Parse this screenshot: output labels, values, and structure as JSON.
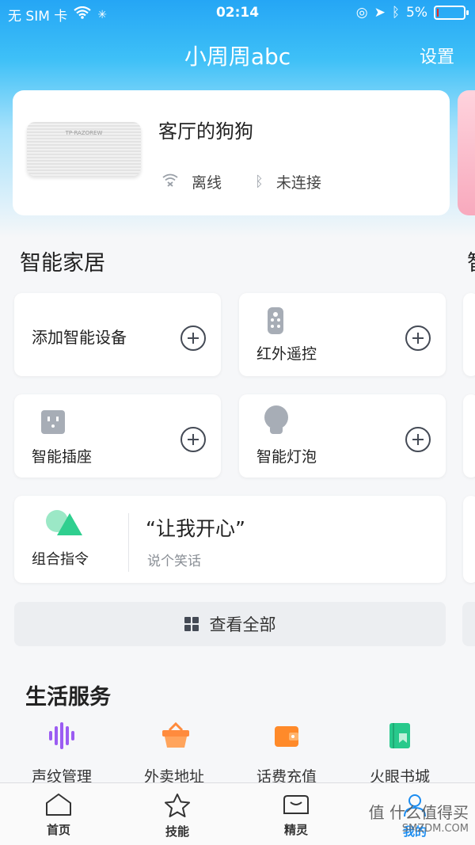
{
  "status_bar": {
    "carrier": "无 SIM 卡",
    "time": "02:14",
    "battery": "5%",
    "battery_level": 0.05
  },
  "nav": {
    "title": "小周周abc",
    "settings_label": "设置"
  },
  "device": {
    "name": "客厅的狗狗",
    "wifi_status": "离线",
    "bt_status": "未连接",
    "brand": "TP-RAZOREW"
  },
  "smart_home": {
    "title": "智能家居",
    "peek_title": "智",
    "add_device": "添加智能设备",
    "ir_remote": "红外遥控",
    "smart_socket": "智能插座",
    "smart_bulb": "智能灯泡"
  },
  "combo": {
    "label": "组合指令",
    "command": "“让我开心”",
    "subtitle": "说个笑话"
  },
  "view_all": "查看全部",
  "life_services": {
    "title": "生活服务",
    "items": [
      {
        "label": "声纹管理",
        "icon": "voiceprint-icon",
        "color": "#9b5cf2"
      },
      {
        "label": "外卖地址",
        "icon": "takeout-icon",
        "color": "#ff8b3d"
      },
      {
        "label": "话费充值",
        "icon": "wallet-icon",
        "color": "#ff8a2a"
      },
      {
        "label": "火眼书城",
        "icon": "book-icon",
        "color": "#28c98c"
      }
    ]
  },
  "tabbar": {
    "items": [
      {
        "label": "首页",
        "icon": "home-icon"
      },
      {
        "label": "技能",
        "icon": "star-icon"
      },
      {
        "label": "精灵",
        "icon": "genie-icon"
      },
      {
        "label": "我的",
        "icon": "user-icon",
        "active": true
      }
    ]
  },
  "watermark": {
    "line1": "值 什么值得买",
    "line2": "SMZDM.COM"
  }
}
